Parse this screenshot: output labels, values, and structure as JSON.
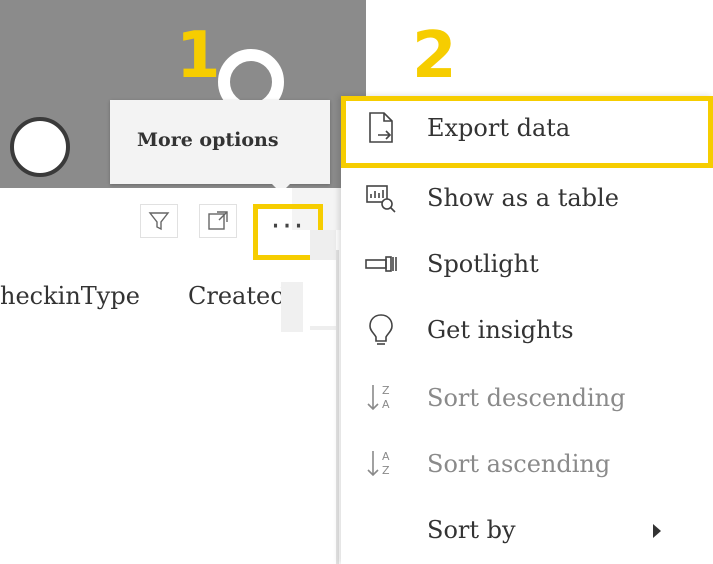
{
  "annotations": {
    "step1": "1",
    "step2": "2",
    "accent_color": "#f6cd00"
  },
  "tooltip": {
    "label": "More options"
  },
  "visual_header": {
    "filter_icon": "filter-icon",
    "focus_icon": "focus-mode-icon",
    "more_options_label": "···"
  },
  "table": {
    "columns": [
      "heckinType",
      "Createc"
    ],
    "sort_indicator": "^"
  },
  "context_menu": {
    "items": [
      {
        "label": "Export data",
        "icon": "export-data-icon",
        "enabled": true
      },
      {
        "label": "Show as a table",
        "icon": "show-as-table-icon",
        "enabled": true
      },
      {
        "label": "Spotlight",
        "icon": "spotlight-icon",
        "enabled": true
      },
      {
        "label": "Get insights",
        "icon": "lightbulb-icon",
        "enabled": true
      },
      {
        "label": "Sort descending",
        "icon": "sort-descending-icon",
        "enabled": false
      },
      {
        "label": "Sort ascending",
        "icon": "sort-ascending-icon",
        "enabled": false
      },
      {
        "label": "Sort by",
        "icon": "chevron-right-icon",
        "enabled": true
      }
    ]
  }
}
